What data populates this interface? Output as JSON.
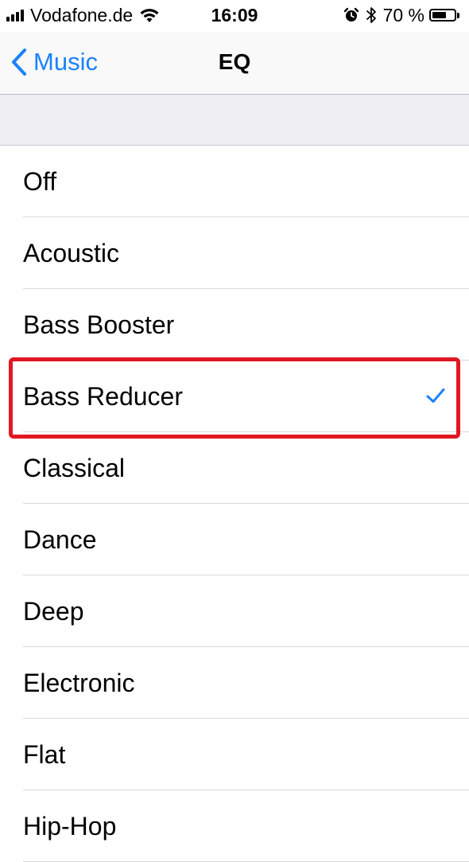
{
  "status_bar": {
    "carrier": "Vodafone.de",
    "time": "16:09",
    "battery_percent": "70 %",
    "battery_level": 0.7,
    "signal_bars": 4,
    "icons": [
      "signal-icon",
      "wifi-icon",
      "alarm-icon",
      "bluetooth-icon",
      "battery-icon"
    ]
  },
  "nav": {
    "back_label": "Music",
    "title": "EQ"
  },
  "eq_options": [
    {
      "label": "Off"
    },
    {
      "label": "Acoustic"
    },
    {
      "label": "Bass Booster"
    },
    {
      "label": "Bass Reducer",
      "selected": true
    },
    {
      "label": "Classical"
    },
    {
      "label": "Dance"
    },
    {
      "label": "Deep"
    },
    {
      "label": "Electronic"
    },
    {
      "label": "Flat"
    },
    {
      "label": "Hip-Hop"
    }
  ],
  "colors": {
    "accent": "#1a82fb",
    "highlight": "#e01822",
    "group_background": "#efeff4"
  }
}
